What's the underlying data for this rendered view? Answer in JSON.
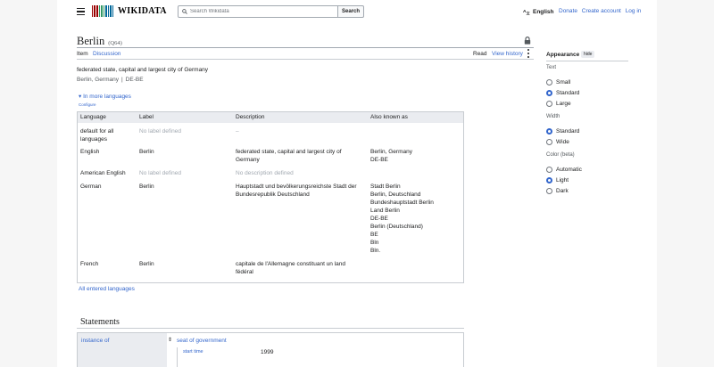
{
  "header": {
    "logo_text": "WIKIDATA",
    "search_placeholder": "Search Wikidata",
    "search_button": "Search",
    "language": "English",
    "links": [
      "Donate",
      "Create account",
      "Log in"
    ]
  },
  "item": {
    "title": "Berlin",
    "qid": "(Q64)",
    "tabs": {
      "item": "Item",
      "discussion": "Discussion",
      "read": "Read",
      "history": "View history"
    },
    "description": "federated state, capital and largest city of Germany",
    "aliases": [
      "Berlin, Germany",
      "DE-BE"
    ],
    "alias_sep": "|",
    "in_more_languages": "In more languages",
    "configure": "Configure",
    "all_entered_languages": "All entered languages"
  },
  "lang_table": {
    "headers": [
      "Language",
      "Label",
      "Description",
      "Also known as"
    ],
    "rows": [
      {
        "language": "default for all languages",
        "label": "No label defined",
        "description": "–",
        "aliases": ""
      },
      {
        "language": "English",
        "label": "Berlin",
        "description": "federated state, capital and largest city of Germany",
        "aliases": "Berlin, Germany\nDE-BE"
      },
      {
        "language": "American English",
        "label": "No label defined",
        "description": "No description defined",
        "aliases": ""
      },
      {
        "language": "German",
        "label": "Berlin",
        "description": "Hauptstadt und bevölkerungsreichste Stadt der Bundesrepublik Deutschland",
        "aliases": "Stadt Berlin\nBerlin, Deutschland\nBundeshauptstadt Berlin\nLand Berlin\nDE-BE\nBerlin (Deutschland)\nBE\nBln\nBln."
      },
      {
        "language": "French",
        "label": "Berlin",
        "description": "capitale de l'Allemagne constituant un land fédéral",
        "aliases": ""
      }
    ]
  },
  "statements": {
    "title": "Statements",
    "property": "instance of",
    "rank_symbol": "⇕",
    "value": "seat of government",
    "qualifier_property": "start time",
    "qualifier_value": "1999"
  },
  "appearance": {
    "title": "Appearance",
    "hide": "hide",
    "text_label": "Text",
    "text_options": [
      "Small",
      "Standard",
      "Large"
    ],
    "width_label": "Width",
    "width_options": [
      "Standard",
      "Wide"
    ],
    "color_label": "Color (beta)",
    "color_options": [
      "Automatic",
      "Light",
      "Dark"
    ]
  },
  "colors": {
    "link": "#3366cc",
    "header_bg": "#eaecf0",
    "border": "#c8ccd1"
  }
}
